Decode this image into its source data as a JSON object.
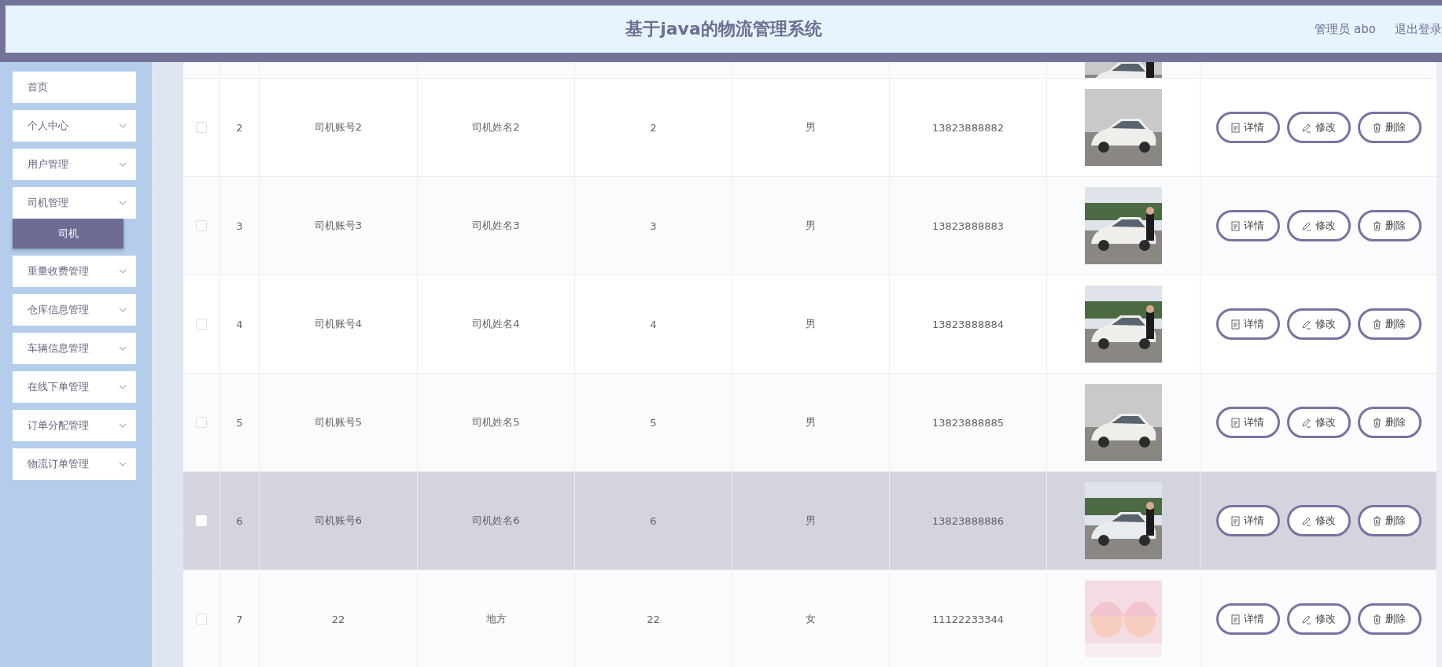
{
  "header": {
    "title": "基于java的物流管理系统",
    "user": "管理员 abo",
    "logout": "退出登录"
  },
  "sidebar": {
    "items": [
      {
        "label": "首页",
        "kind": "link"
      },
      {
        "label": "个人中心",
        "kind": "submenu"
      },
      {
        "label": "用户管理",
        "kind": "submenu"
      },
      {
        "label": "司机管理",
        "kind": "submenu",
        "children": [
          {
            "label": "司机",
            "selected": true
          }
        ]
      },
      {
        "label": "重量收费管理",
        "kind": "submenu"
      },
      {
        "label": "仓库信息管理",
        "kind": "submenu"
      },
      {
        "label": "车辆信息管理",
        "kind": "submenu"
      },
      {
        "label": "在线下单管理",
        "kind": "submenu"
      },
      {
        "label": "订单分配管理",
        "kind": "submenu"
      },
      {
        "label": "物流订单管理",
        "kind": "submenu"
      }
    ]
  },
  "table": {
    "rows": [
      {
        "index": "2",
        "account": "司机账号2",
        "name": "司机姓名2",
        "column_4": "2",
        "gender": "男",
        "phone": "13823888882",
        "selected": false,
        "actions": [
          {
            "label": "详情",
            "kind": "detail"
          },
          {
            "label": "修改",
            "kind": "edit"
          },
          {
            "label": "删除",
            "kind": "delete"
          }
        ]
      },
      {
        "index": "3",
        "account": "司机账号3",
        "name": "司机姓名3",
        "column_4": "3",
        "gender": "男",
        "phone": "13823888883",
        "selected": false,
        "actions": [
          {
            "label": "详情",
            "kind": "detail"
          },
          {
            "label": "修改",
            "kind": "edit"
          },
          {
            "label": "删除",
            "kind": "delete"
          }
        ]
      },
      {
        "index": "4",
        "account": "司机账号4",
        "name": "司机姓名4",
        "column_4": "4",
        "gender": "男",
        "phone": "13823888884",
        "selected": false,
        "actions": [
          {
            "label": "详情",
            "kind": "detail"
          },
          {
            "label": "修改",
            "kind": "edit"
          },
          {
            "label": "删除",
            "kind": "delete"
          }
        ]
      },
      {
        "index": "5",
        "account": "司机账号5",
        "name": "司机姓名5",
        "column_4": "5",
        "gender": "男",
        "phone": "13823888885",
        "selected": false,
        "actions": [
          {
            "label": "详情",
            "kind": "detail"
          },
          {
            "label": "修改",
            "kind": "edit"
          },
          {
            "label": "删除",
            "kind": "delete"
          }
        ]
      },
      {
        "index": "6",
        "account": "司机账号6",
        "name": "司机姓名6",
        "column_4": "6",
        "gender": "男",
        "phone": "13823888886",
        "selected": true,
        "actions": [
          {
            "label": "详情",
            "kind": "detail"
          },
          {
            "label": "修改",
            "kind": "edit"
          },
          {
            "label": "删除",
            "kind": "delete"
          }
        ]
      },
      {
        "index": "7",
        "account": "22",
        "name": "地方",
        "column_4": "22",
        "gender": "女",
        "phone": "11122233344",
        "selected": false,
        "actions": [
          {
            "label": "详情",
            "kind": "detail"
          },
          {
            "label": "修改",
            "kind": "edit"
          },
          {
            "label": "删除",
            "kind": "delete"
          }
        ]
      }
    ]
  }
}
